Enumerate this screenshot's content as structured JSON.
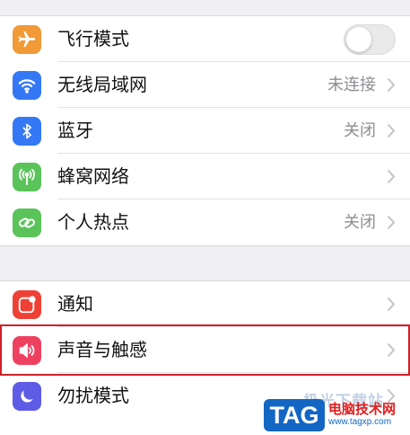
{
  "colors": {
    "airplane": "#f19a37",
    "wifi": "#3478f6",
    "bluetooth": "#3478f6",
    "cellular": "#5ac35a",
    "hotspot": "#5ac35a",
    "notifications": "#ee4136",
    "sounds": "#ee4160",
    "dnd": "#5e5ce6",
    "highlight": "#d0202a"
  },
  "group1": [
    {
      "label": "飞行模式",
      "icon": "airplane-icon",
      "control": "toggle",
      "toggle_on": false
    },
    {
      "label": "无线局域网",
      "icon": "wifi-icon",
      "value": "未连接"
    },
    {
      "label": "蓝牙",
      "icon": "bluetooth-icon",
      "value": "关闭"
    },
    {
      "label": "蜂窝网络",
      "icon": "cellular-icon",
      "value": ""
    },
    {
      "label": "个人热点",
      "icon": "hotspot-icon",
      "value": "关闭"
    }
  ],
  "group2": [
    {
      "label": "通知",
      "icon": "notifications-icon",
      "value": ""
    },
    {
      "label": "声音与触感",
      "icon": "sounds-icon",
      "value": ""
    },
    {
      "label": "勿扰模式",
      "icon": "moon-icon",
      "value": ""
    }
  ],
  "watermark": {
    "faint": "极光下载站",
    "badge": "TAG",
    "name": "电脑技术网",
    "url": "www.tagxp.com"
  }
}
